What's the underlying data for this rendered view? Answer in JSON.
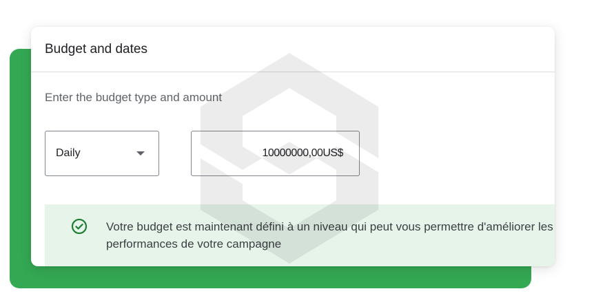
{
  "card": {
    "title": "Budget and dates",
    "subtitle": "Enter the budget type and amount"
  },
  "budget": {
    "type_value": "Daily",
    "amount_value": "10000000,00US$"
  },
  "notice": {
    "text": "Votre budget est maintenant défini à un niveau qui peut vous permettre d'améliorer les performances de votre campagne",
    "icon": "check-circle-icon"
  },
  "colors": {
    "accent_green": "#34a853",
    "notice_bg": "#e6f4ea",
    "check_green": "#1e7e34"
  }
}
